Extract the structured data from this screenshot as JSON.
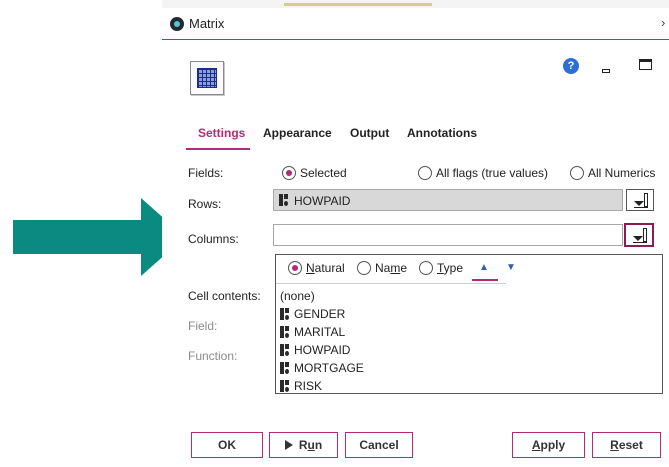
{
  "window": {
    "title": "Matrix"
  },
  "header": {
    "help_glyph": "?"
  },
  "tabs": [
    {
      "label": "Settings",
      "active": true
    },
    {
      "label": "Appearance",
      "active": false
    },
    {
      "label": "Output",
      "active": false
    },
    {
      "label": "Annotations",
      "active": false
    }
  ],
  "fields": {
    "label": "Fields:",
    "options": [
      {
        "label": "Selected",
        "checked": true
      },
      {
        "label": "All flags (true values)",
        "checked": false
      },
      {
        "label": "All Numerics",
        "checked": false
      }
    ]
  },
  "rows": {
    "label": "Rows:",
    "value": "HOWPAID"
  },
  "columns": {
    "label": "Columns:",
    "value": ""
  },
  "cell_contents": {
    "label": "Cell contents:"
  },
  "field": {
    "label": "Field:"
  },
  "function": {
    "label": "Function:"
  },
  "dropdown": {
    "sort_options": [
      {
        "label": "Natural",
        "mnemonic": "N",
        "rest": "atural",
        "checked": true
      },
      {
        "label": "Name",
        "mnemonic_prefix": "Na",
        "mnemonic": "m",
        "rest": "e",
        "checked": false
      },
      {
        "label": "Type",
        "mnemonic": "T",
        "rest": "ype",
        "checked": false
      }
    ],
    "sort_up_glyph": "▲",
    "sort_down_glyph": "▼",
    "items": [
      "(none)",
      "GENDER",
      "MARITAL",
      "HOWPAID",
      "MORTGAGE",
      "RISK"
    ]
  },
  "buttons": {
    "ok": "OK",
    "run_prefix": "R",
    "run_mnemonic": "u",
    "run_rest": "n",
    "cancel": "Cancel",
    "apply_mnemonic": "A",
    "apply_rest": "pply",
    "reset_mnemonic": "R",
    "reset_rest": "eset"
  },
  "colors": {
    "accent": "#b52a74",
    "annotation_arrow": "#0a8a80",
    "sort_arrow": "#2d5fb4",
    "help": "#2d6fd6"
  },
  "icons": {
    "app": "app-logo-icon",
    "node": "matrix-node-icon",
    "help": "help-icon",
    "minimize": "minimize-icon",
    "maximize": "maximize-icon",
    "close": "close-icon",
    "field_picker": "field-picker-icon",
    "field_type": "set-type-icon",
    "annotation": "right-arrow-icon"
  }
}
